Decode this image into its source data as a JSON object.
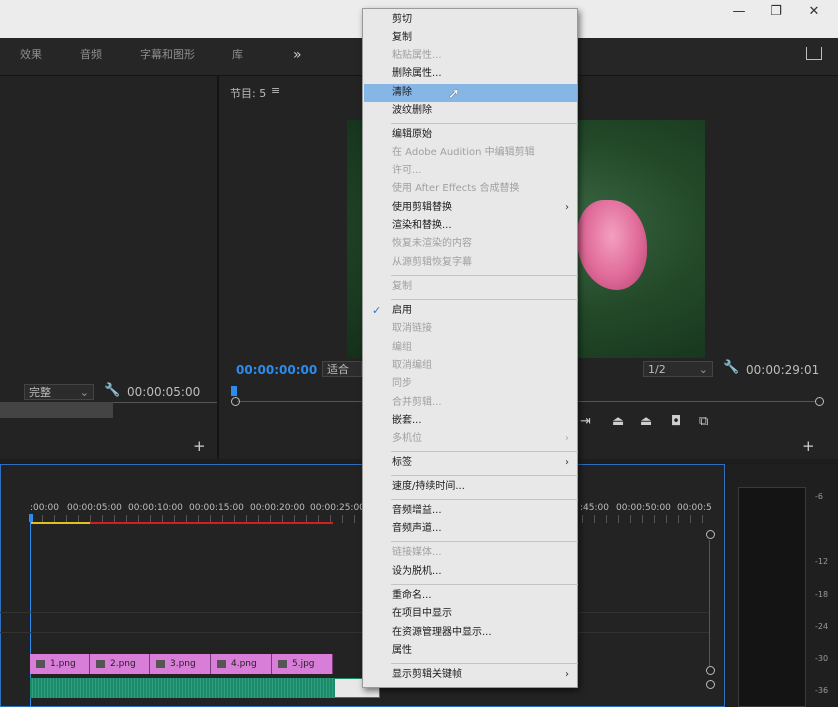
{
  "workspace_tabs": [
    "效果",
    "音频",
    "字幕和图形",
    "库"
  ],
  "workspace_more": "»",
  "window_controls": {
    "minimize": "—",
    "maximize": "❐",
    "close": "✕"
  },
  "program": {
    "title": "节目: 5",
    "menu_icon": "≡",
    "timecode_current": "00:00:00:00",
    "fit_label": "适合",
    "resolution": "1/2",
    "timecode_duration": "00:00:29:01",
    "add": "+"
  },
  "source": {
    "quality": "完整",
    "timecode": "00:00:05:00",
    "add": "+"
  },
  "timeline": {
    "ruler_labels": [
      ":00:00",
      "00:00:05:00",
      "00:00:10:00",
      "00:00:15:00",
      "00:00:20:00",
      "00:00:25:00",
      ":45:00",
      "00:00:50:00",
      "00:00:5"
    ],
    "clips": [
      "1.png",
      "2.png",
      "3.png",
      "4.png",
      "5.jpg"
    ]
  },
  "meter_labels": [
    "-6",
    "-12",
    "-18",
    "-24",
    "-30",
    "-36"
  ],
  "context_menu": {
    "items": [
      {
        "label": "剪切",
        "enabled": true
      },
      {
        "label": "复制",
        "enabled": true
      },
      {
        "label": "粘贴属性...",
        "enabled": false
      },
      {
        "label": "删除属性...",
        "enabled": true
      },
      {
        "label": "清除",
        "enabled": true,
        "highlighted": true
      },
      {
        "label": "波纹删除",
        "enabled": true
      },
      {
        "label": "编辑原始",
        "enabled": true
      },
      {
        "label": "在 Adobe Audition 中编辑剪辑",
        "enabled": false
      },
      {
        "label": "许可...",
        "enabled": false
      },
      {
        "label": "使用 After Effects 合成替换",
        "enabled": false
      },
      {
        "label": "使用剪辑替换",
        "enabled": true,
        "submenu": true
      },
      {
        "label": "渲染和替换...",
        "enabled": true
      },
      {
        "label": "恢复未渲染的内容",
        "enabled": false
      },
      {
        "label": "从源剪辑恢复字幕",
        "enabled": false
      },
      {
        "label": "复制",
        "enabled": false
      },
      {
        "label": "启用",
        "enabled": true,
        "checked": true
      },
      {
        "label": "取消链接",
        "enabled": false
      },
      {
        "label": "编组",
        "enabled": false
      },
      {
        "label": "取消编组",
        "enabled": false
      },
      {
        "label": "同步",
        "enabled": false
      },
      {
        "label": "合并剪辑...",
        "enabled": false
      },
      {
        "label": "嵌套...",
        "enabled": true
      },
      {
        "label": "多机位",
        "enabled": false,
        "submenu": true
      },
      {
        "label": "标签",
        "enabled": true,
        "submenu": true
      },
      {
        "label": "速度/持续时间...",
        "enabled": true
      },
      {
        "label": "音频增益...",
        "enabled": true
      },
      {
        "label": "音频声道...",
        "enabled": true
      },
      {
        "label": "链接媒体...",
        "enabled": false
      },
      {
        "label": "设为脱机...",
        "enabled": true
      },
      {
        "label": "重命名...",
        "enabled": true
      },
      {
        "label": "在项目中显示",
        "enabled": true
      },
      {
        "label": "在资源管理器中显示...",
        "enabled": true
      },
      {
        "label": "属性",
        "enabled": true
      },
      {
        "label": "显示剪辑关键帧",
        "enabled": true,
        "submenu": true
      }
    ],
    "check_glyph": "✓",
    "arrow_glyph": "›"
  },
  "colors": {
    "accent_blue": "#2d8ceb",
    "menu_highlight": "#86b6e6",
    "clip_pink": "#d87ed8",
    "audio_green": "#1e8a6a"
  }
}
